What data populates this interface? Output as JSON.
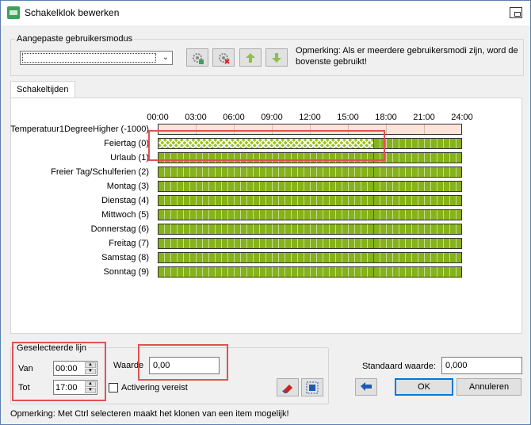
{
  "window": {
    "title": "Schakelklok bewerken"
  },
  "user_modes": {
    "group_label": "Aangepaste gebruikersmodus",
    "combo_value": "",
    "toolbar": [
      {
        "icon": "add-gear-icon"
      },
      {
        "icon": "remove-gear-icon"
      },
      {
        "icon": "arrow-up-icon"
      },
      {
        "icon": "arrow-down-icon"
      }
    ],
    "note": "Opmerking: Als er meerdere gebruikersmodi zijn, word de bovenste gebruikt!"
  },
  "tab": {
    "label": "Schakeltijden"
  },
  "schedule": {
    "hours": [
      "00:00",
      "03:00",
      "06:00",
      "09:00",
      "12:00",
      "15:00",
      "18:00",
      "21:00",
      "24:00"
    ],
    "now_marker_time": "17:00",
    "rows": [
      {
        "label": "Temperatuur1DegreeHigher (-1000)",
        "style": "empty"
      },
      {
        "label": "Feiertag (0)",
        "style": "selected",
        "selected_from": "00:00",
        "selected_to": "17:00"
      },
      {
        "label": "Urlaub (1)",
        "style": "filled"
      },
      {
        "label": "Freier Tag/Schulferien (2)",
        "style": "filled"
      },
      {
        "label": "Montag (3)",
        "style": "filled"
      },
      {
        "label": "Dienstag (4)",
        "style": "filled"
      },
      {
        "label": "Mittwoch (5)",
        "style": "filled"
      },
      {
        "label": "Donnerstag (6)",
        "style": "filled"
      },
      {
        "label": "Freitag (7)",
        "style": "filled"
      },
      {
        "label": "Samstag (8)",
        "style": "filled"
      },
      {
        "label": "Sonntag (9)",
        "style": "filled"
      }
    ],
    "colors": {
      "active": "#86b21a",
      "empty": "#fde4d8",
      "now_line": "#d02020",
      "highlight": "#e05252"
    }
  },
  "selected_line": {
    "group_label": "Geselecteerde lijn",
    "from_label": "Van",
    "from_value": "00:00",
    "to_label": "Tot",
    "to_value": "17:00"
  },
  "value": {
    "label": "Waarde",
    "value": "0,00"
  },
  "activation": {
    "label": "Activering vereist",
    "checked": false
  },
  "tools": [
    {
      "icon": "eraser-icon"
    },
    {
      "icon": "select-area-icon"
    }
  ],
  "default_value": {
    "label": "Standaard waarde:",
    "value": "0,000"
  },
  "buttons": {
    "back_icon": "undo-arrow-icon",
    "ok": "OK",
    "cancel": "Annuleren"
  },
  "status_note": "Opmerking: Met Ctrl selecteren maakt het klonen van een item mogelijk!"
}
